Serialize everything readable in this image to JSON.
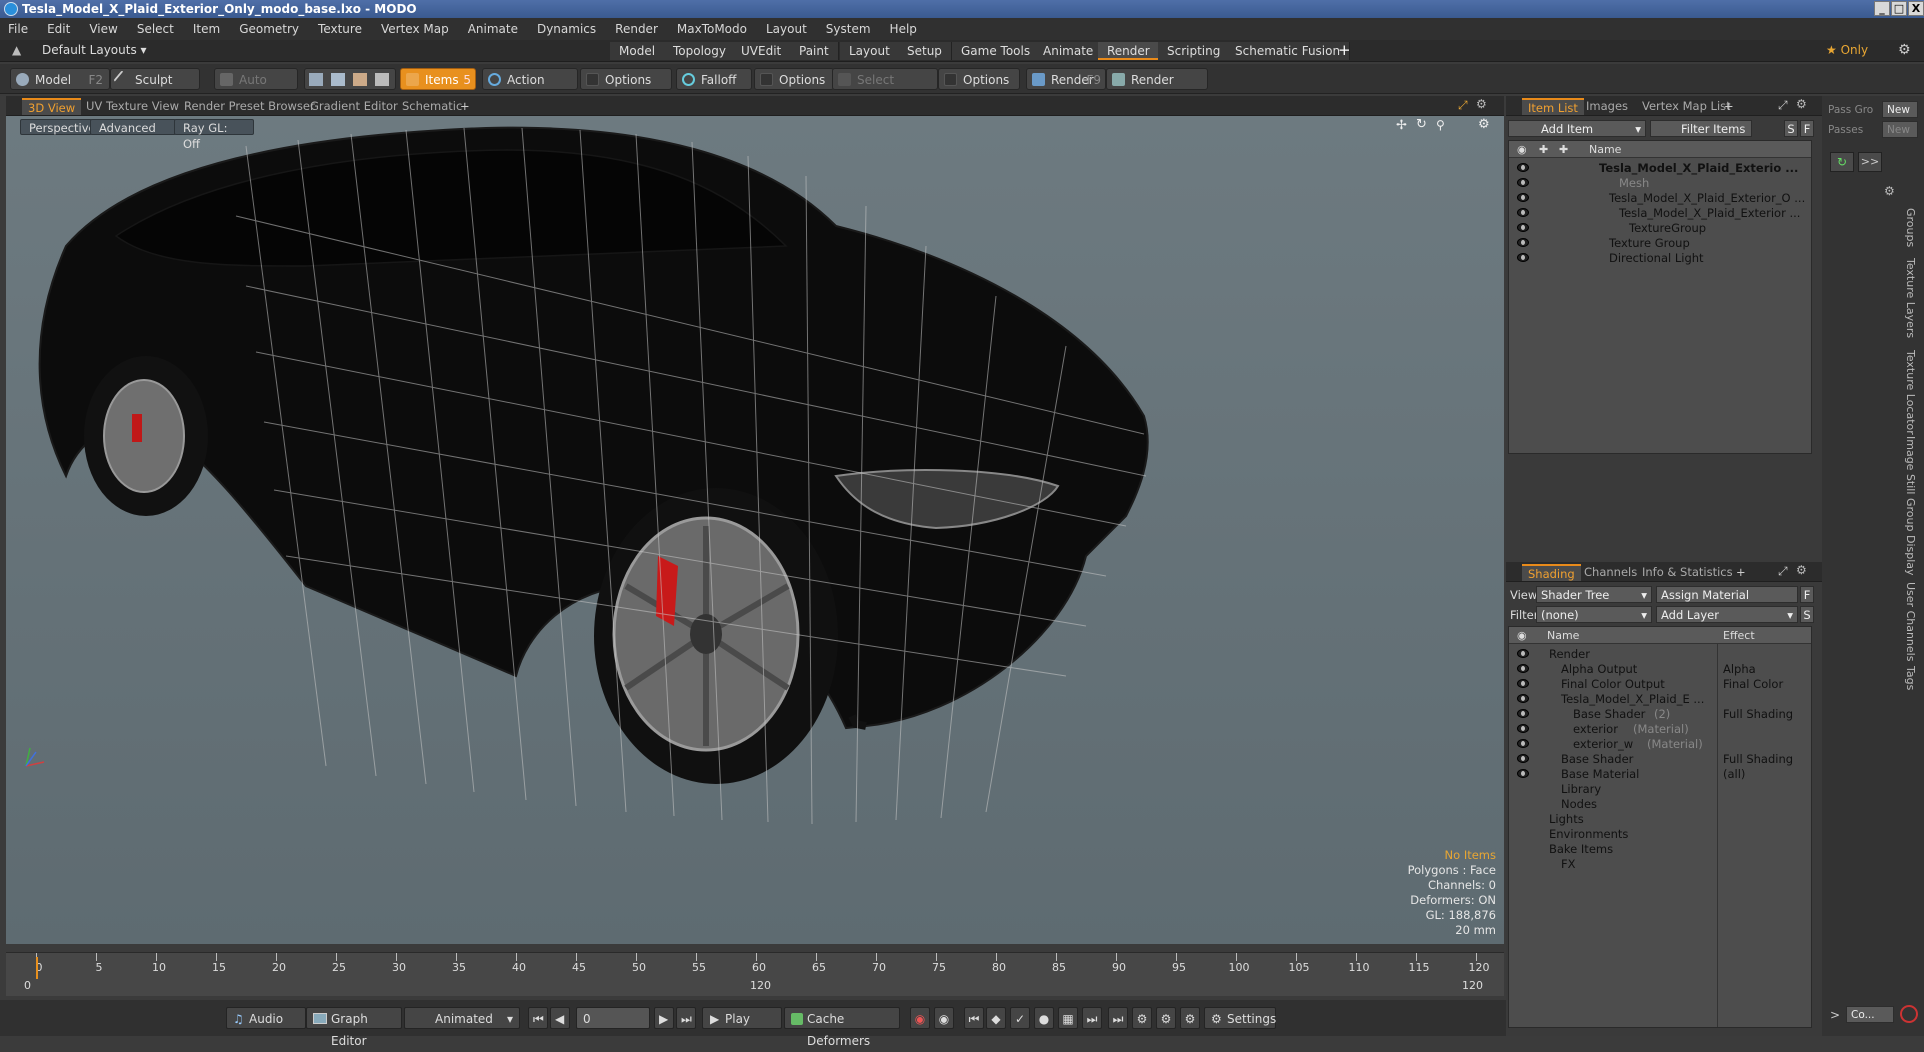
{
  "window": {
    "title": "Tesla_Model_X_Plaid_Exterior_Only_modo_base.lxo - MODO",
    "min": "_",
    "max": "□",
    "close": "X"
  },
  "menu": [
    "File",
    "Edit",
    "View",
    "Select",
    "Item",
    "Geometry",
    "Texture",
    "Vertex Map",
    "Animate",
    "Dynamics",
    "Render",
    "MaxToModo",
    "Layout",
    "System",
    "Help"
  ],
  "layout": {
    "default_layouts": "Default Layouts ▾",
    "tabs": [
      "Model",
      "Topology",
      "UVEdit",
      "Paint",
      "Layout",
      "Setup",
      "Game Tools",
      "Animate",
      "Render",
      "Scripting",
      "Schematic Fusion"
    ],
    "active": "Render",
    "only": "★ Only",
    "add": "+"
  },
  "toolbar": {
    "model": "Model",
    "model_key": "F2",
    "sculpt": "Sculpt",
    "auto_select": "Auto Select",
    "items": "Items",
    "items_key": "5",
    "action_center": "Action Center",
    "options1": "Options",
    "falloff": "Falloff",
    "options2": "Options",
    "select_through": "Select Through",
    "options3": "Options",
    "render": "Render",
    "render_key": "F9",
    "render_window": "Render Window"
  },
  "viewport_tabs": [
    "3D View",
    "UV Texture View",
    "Render Preset Browser",
    "Gradient Editor",
    "Schematic"
  ],
  "viewport_tabs_add": "+",
  "viewport": {
    "perspective": "Perspective",
    "advanced": "Advanced",
    "raygl": "Ray GL: Off"
  },
  "info": {
    "no_items": "No Items",
    "polygons": "Polygons : Face",
    "channels": "Channels: 0",
    "deformers": "Deformers: ON",
    "gl": "GL: 188,876",
    "scale": "20 mm"
  },
  "timeline": {
    "ticks": [
      0,
      5,
      10,
      15,
      20,
      25,
      30,
      35,
      40,
      45,
      50,
      55,
      60,
      65,
      70,
      75,
      80,
      85,
      90,
      95,
      100,
      105,
      110,
      115,
      120
    ],
    "lower": [
      "0",
      "120",
      "120"
    ]
  },
  "transport": {
    "audio": "Audio",
    "graph_editor": "Graph Editor",
    "animated": "Animated",
    "frame": "0",
    "play": "Play",
    "cache_deformers": "Cache Deformers",
    "settings": "Settings"
  },
  "itemlist": {
    "tabs": [
      "Item List",
      "Images",
      "Vertex Map List"
    ],
    "tabs_add": "+",
    "add_item": "Add Item",
    "filter_items": "Filter Items",
    "s": "S",
    "f": "F",
    "col_name": "Name",
    "rows": [
      {
        "label": "Tesla_Model_X_Plaid_Exterio ...",
        "bold": true,
        "indent": 0
      },
      {
        "label": "Mesh",
        "dim": true,
        "indent": 2
      },
      {
        "label": "Tesla_Model_X_Plaid_Exterior_O ...",
        "indent": 1
      },
      {
        "label": "Tesla_Model_X_Plaid_Exterior ...",
        "indent": 2
      },
      {
        "label": "TextureGroup",
        "indent": 3
      },
      {
        "label": "Texture Group",
        "indent": 1
      },
      {
        "label": "Directional Light",
        "indent": 1
      }
    ]
  },
  "shading": {
    "tabs": [
      "Shading",
      "Channels",
      "Info & Statistics"
    ],
    "tabs_add": "+",
    "view_label": "View",
    "view_value": "Shader Tree",
    "assign_material": "Assign Material",
    "f": "F",
    "filter_label": "Filter",
    "filter_value": "(none)",
    "add_layer": "Add Layer",
    "s": "S",
    "col_name": "Name",
    "col_effect": "Effect",
    "rows": [
      {
        "label": "Render",
        "effect": "",
        "indent": 0
      },
      {
        "label": "Alpha Output",
        "effect": "Alpha",
        "indent": 1
      },
      {
        "label": "Final Color Output",
        "effect": "Final Color",
        "indent": 1
      },
      {
        "label": "Tesla_Model_X_Plaid_E ...",
        "effect": "",
        "indent": 1
      },
      {
        "label": "Base Shader",
        "suffix": "(2)",
        "effect": "Full Shading",
        "indent": 2
      },
      {
        "label": "exterior",
        "suffix": "(Material)",
        "effect": "",
        "indent": 2
      },
      {
        "label": "exterior_w",
        "suffix": "(Material)",
        "effect": "",
        "indent": 2
      },
      {
        "label": "Base Shader",
        "effect": "Full Shading",
        "indent": 1
      },
      {
        "label": "Base Material",
        "effect": "(all)",
        "indent": 1
      },
      {
        "label": "Library",
        "effect": "",
        "indent": 1
      },
      {
        "label": "Nodes",
        "effect": "",
        "indent": 1
      },
      {
        "label": "Lights",
        "effect": "",
        "indent": 0
      },
      {
        "label": "Environments",
        "effect": "",
        "indent": 0
      },
      {
        "label": "Bake Items",
        "effect": "",
        "indent": 0
      },
      {
        "label": "FX",
        "effect": "",
        "indent": 1
      }
    ]
  },
  "passes": {
    "pass_group": "Pass Gro",
    "passes": "Passes",
    "new1": "New",
    "new2": "New",
    "arrows": ">>"
  },
  "sidetabs": [
    "Groups",
    "Texture Layers",
    "Texture Locator",
    "Image Still",
    "Group Display",
    "User Channels",
    "Tags"
  ],
  "bottom_right": {
    "chevron": ">",
    "co": "Co..."
  }
}
